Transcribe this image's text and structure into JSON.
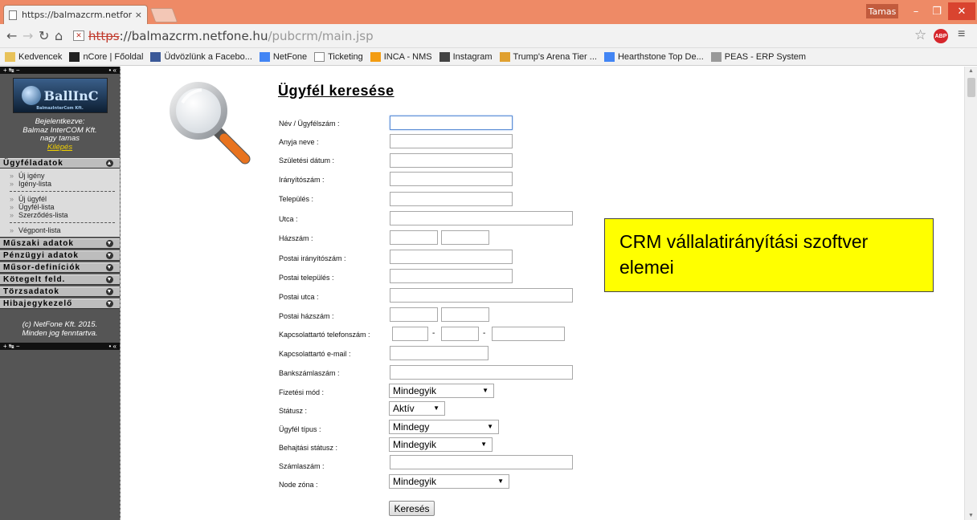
{
  "browser": {
    "tab_title": "https://balmazcrm.netfone",
    "tab_close": "×",
    "user": "Tamas",
    "url_scheme": "https",
    "url_rest": "://balmazcrm.netfone.hu",
    "url_path": "/pubcrm/main.jsp",
    "bookmarks": [
      {
        "label": "Kedvencek",
        "icon": "folder-icon",
        "color": "#e8c25a"
      },
      {
        "label": "nCore | Főoldal",
        "icon": "ncore-icon",
        "color": "#222222"
      },
      {
        "label": "Üdvözlünk a Facebo...",
        "icon": "facebook-icon",
        "color": "#3b5998"
      },
      {
        "label": "NetFone",
        "icon": "google-sites-icon",
        "color": "#4285f4"
      },
      {
        "label": "Ticketing",
        "icon": "page-icon",
        "color": "#ffffff"
      },
      {
        "label": "INCA - NMS",
        "icon": "inca-icon",
        "color": "#f39c12"
      },
      {
        "label": "Instagram",
        "icon": "instagram-icon",
        "color": "#444444"
      },
      {
        "label": "Trump's Arena Tier ...",
        "icon": "hearthstone-icon",
        "color": "#e0a030"
      },
      {
        "label": "Hearthstone Top De...",
        "icon": "google-sites-icon",
        "color": "#4285f4"
      },
      {
        "label": "PEAS - ERP System",
        "icon": "peas-icon",
        "color": "#999999"
      }
    ]
  },
  "sidebar": {
    "strip_left": "+ ↹ −",
    "strip_right": "• «",
    "logo_text": "BallInC",
    "logo_sub": "BalmazInterCom Kft.",
    "login_line1": "Bejelentkezve:",
    "login_line2": "Balmaz InterCOM Kft.",
    "login_line3": "nagy tamas",
    "logout": "Kilépés",
    "sections": [
      {
        "label": "Ügyféladatok",
        "icon": "collapse-icon"
      },
      {
        "label": "Műszaki adatok",
        "icon": "expand-icon"
      },
      {
        "label": "Pénzügyi adatok",
        "icon": "expand-icon"
      },
      {
        "label": "Műsor-definíciók",
        "icon": "expand-icon"
      },
      {
        "label": "Kötegelt feld.",
        "icon": "expand-icon"
      },
      {
        "label": "Törzsadatok",
        "icon": "expand-icon"
      },
      {
        "label": "Hibajegykezelő",
        "icon": "expand-icon"
      }
    ],
    "items": [
      "Új igény",
      "Igény-lista",
      "Új ügyfél",
      "Ügyfél-lista",
      "Szerződés-lista",
      "Végpont-lista"
    ],
    "copyright1": "(c) NetFone Kft. 2015.",
    "copyright2": "Minden jog fenntartva."
  },
  "form": {
    "title": "Ügyfél keresése",
    "labels": {
      "name": "Név / Ügyfélszám :",
      "mother": "Anyja neve :",
      "birth": "Születési dátum :",
      "zip": "Irányítószám :",
      "city": "Település :",
      "street": "Utca :",
      "house": "Házszám :",
      "postal_zip": "Postai irányítószám :",
      "postal_city": "Postai település :",
      "postal_street": "Postai utca :",
      "postal_house": "Postai házszám :",
      "phone": "Kapcsolattartó telefonszám :",
      "email": "Kapcsolattartó e-mail :",
      "bank": "Bankszámlaszám :",
      "payment": "Fizetési mód :",
      "status": "Státusz :",
      "type": "Ügyfél típus :",
      "collection": "Behajtási státusz :",
      "invoice": "Számlaszám :",
      "node": "Node zóna :"
    },
    "selects": {
      "payment": "Mindegyik",
      "status": "Aktív",
      "type": "Mindegy",
      "collection": "Mindegyik",
      "node": "Mindegyik"
    },
    "dash": "-",
    "search_button": "Keresés"
  },
  "note": {
    "line1": "CRM vállalatirányítási szoftver",
    "line2": "elemei",
    "color": "#ffff00"
  }
}
